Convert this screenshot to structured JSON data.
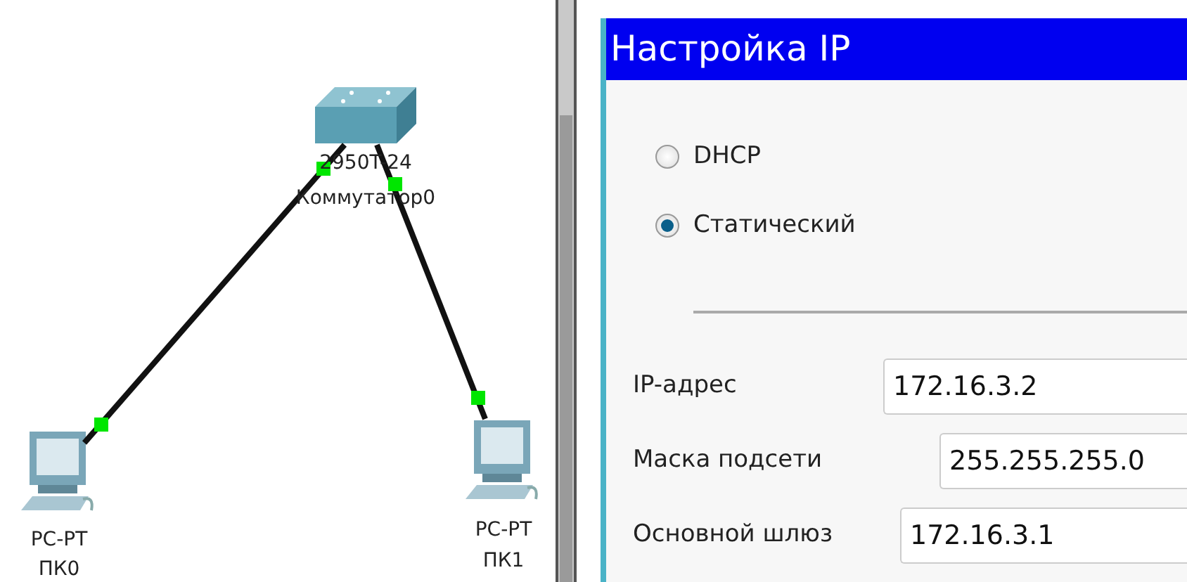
{
  "topology": {
    "devices": [
      {
        "kind": "switch",
        "model": "2950T-24",
        "name": "Коммутатор0"
      },
      {
        "kind": "pc",
        "model": "PC-PT",
        "name": "ПК0"
      },
      {
        "kind": "pc",
        "model": "PC-PT",
        "name": "ПК1"
      }
    ],
    "links": [
      {
        "up": true
      },
      {
        "up": true
      }
    ]
  },
  "dialog": {
    "title": "Настройка IP",
    "modes": [
      {
        "label": "DHCP",
        "selected": false
      },
      {
        "label": "Статический",
        "selected": true
      }
    ],
    "fields": [
      {
        "label": "IP-адрес",
        "value": "172.16.3.2"
      },
      {
        "label": "Маска подсети",
        "value": "255.255.255.0"
      },
      {
        "label": "Основной шлюз",
        "value": "172.16.3.1"
      }
    ]
  }
}
